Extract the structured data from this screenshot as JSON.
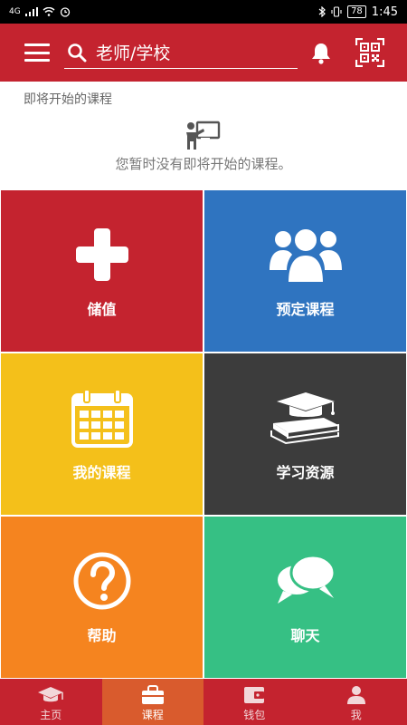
{
  "status_bar": {
    "network": "4G",
    "battery": "78",
    "time": "1:45"
  },
  "header": {
    "search_placeholder": "老师/学校",
    "icons": [
      "menu-icon",
      "search-icon",
      "bell-icon",
      "qr-code-icon"
    ]
  },
  "upcoming": {
    "title": "即将开始的课程",
    "empty_message": "您暂时没有即将开始的课程。",
    "icon": "teacher-board-icon"
  },
  "tiles": [
    {
      "label": "储值",
      "icon": "plus-icon",
      "color": "#c4232f"
    },
    {
      "label": "预定课程",
      "icon": "users-group-icon",
      "color": "#2f74c0"
    },
    {
      "label": "我的课程",
      "icon": "calendar-icon",
      "color": "#f4c01a"
    },
    {
      "label": "学习资源",
      "icon": "books-graduation-cap-icon",
      "color": "#3c3c3c"
    },
    {
      "label": "帮助",
      "icon": "question-icon",
      "color": "#f5841f"
    },
    {
      "label": "聊天",
      "icon": "chat-bubbles-icon",
      "color": "#36c084"
    }
  ],
  "bottom_nav": [
    {
      "label": "主页",
      "icon": "graduation-cap-icon",
      "active": false
    },
    {
      "label": "课程",
      "icon": "briefcase-icon",
      "active": true
    },
    {
      "label": "钱包",
      "icon": "wallet-icon",
      "active": false
    },
    {
      "label": "我",
      "icon": "person-icon",
      "active": false
    }
  ],
  "colors": {
    "brand": "#c4232f",
    "active_tab": "#d95b2d"
  }
}
